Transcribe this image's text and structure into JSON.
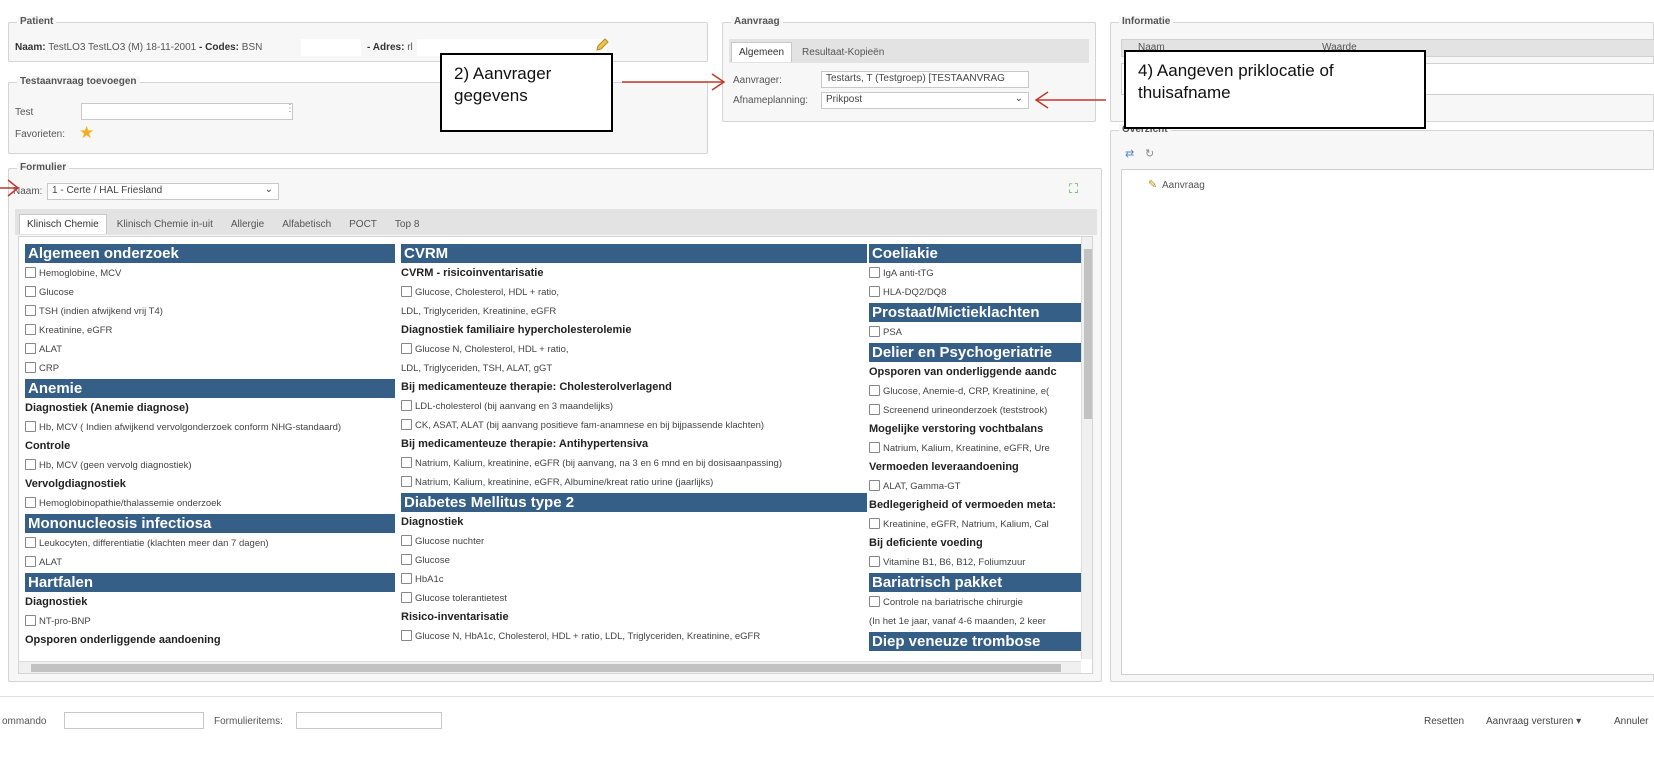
{
  "patient": {
    "legend": "Patient",
    "naam_label": "Naam:",
    "naam_value": "TestLO3 TestLO3 (M) 18-11-2001",
    "codes_label": "- Codes:",
    "bsn_label": "BSN",
    "adres_label": "- Adres:",
    "adres_value": "rl"
  },
  "testaanvraag": {
    "legend": "Testaanvraag toevoegen",
    "test_label": "Test",
    "favorieten_label": "Favorieten:"
  },
  "aanvraag": {
    "legend": "Aanvraag",
    "tabs": [
      "Algemeen",
      "Resultaat-Kopieën"
    ],
    "aanvrager_label": "Aanvrager:",
    "aanvrager_value": "Testarts, T (Testgroep) [TESTAANVRAG",
    "afname_label": "Afnameplanning:",
    "afname_value": "Prikpost"
  },
  "informatie": {
    "legend": "Informatie",
    "col_naam": "Naam",
    "col_waarde": "Waarde",
    "overzicht_legend": "Overzicht",
    "tree_item": "Aanvraag"
  },
  "formulier": {
    "legend": "Formulier",
    "naam_label": "Naam:",
    "naam_value": "1 - Certe / HAL Friesland",
    "tabs": [
      "Klinisch Chemie",
      "Klinisch Chemie in-uit",
      "Allergie",
      "Alfabetisch",
      "POCT",
      "Top 8"
    ]
  },
  "col1": [
    {
      "t": "h",
      "v": "Algemeen onderzoek"
    },
    {
      "t": "c",
      "v": "Hemoglobine, MCV"
    },
    {
      "t": "c",
      "v": "Glucose"
    },
    {
      "t": "c",
      "v": "TSH (indien afwijkend vrij T4)"
    },
    {
      "t": "c",
      "v": "Kreatinine, eGFR"
    },
    {
      "t": "c",
      "v": "ALAT"
    },
    {
      "t": "c",
      "v": "CRP"
    },
    {
      "t": "h",
      "v": "Anemie"
    },
    {
      "t": "s",
      "v": "Diagnostiek (Anemie diagnose)"
    },
    {
      "t": "c",
      "v": "Hb, MCV ( Indien afwijkend vervolgonderzoek conform NHG-standaard)"
    },
    {
      "t": "s",
      "v": "Controle"
    },
    {
      "t": "c",
      "v": "Hb, MCV (geen vervolg diagnostiek)"
    },
    {
      "t": "s",
      "v": "Vervolgdiagnostiek"
    },
    {
      "t": "c",
      "v": "Hemoglobinopathie/thalassemie onderzoek"
    },
    {
      "t": "h",
      "v": "Mononucleosis infectiosa"
    },
    {
      "t": "c",
      "v": "Leukocyten, differentiatie (klachten meer dan 7 dagen)"
    },
    {
      "t": "c",
      "v": "ALAT"
    },
    {
      "t": "h",
      "v": "Hartfalen"
    },
    {
      "t": "s",
      "v": "Diagnostiek"
    },
    {
      "t": "c",
      "v": "NT-pro-BNP"
    },
    {
      "t": "s",
      "v": "Opsporen onderliggende aandoening"
    }
  ],
  "col2": [
    {
      "t": "h",
      "v": "CVRM"
    },
    {
      "t": "s",
      "v": "CVRM - risicoinventarisatie"
    },
    {
      "t": "c",
      "v": "Glucose, Cholesterol, HDL + ratio,"
    },
    {
      "t": "p",
      "v": "LDL, Triglyceriden, Kreatinine, eGFR"
    },
    {
      "t": "s",
      "v": "Diagnostiek familiaire hypercholesterolemie"
    },
    {
      "t": "c",
      "v": "Glucose N, Cholesterol, HDL + ratio,"
    },
    {
      "t": "p",
      "v": "LDL, Triglyceriden, TSH, ALAT, gGT"
    },
    {
      "t": "s",
      "v": "Bij medicamenteuze therapie: Cholesterolverlagend"
    },
    {
      "t": "c",
      "v": "LDL-cholesterol (bij aanvang en 3 maandelijks)"
    },
    {
      "t": "c",
      "v": "CK, ASAT, ALAT (bij aanvang positieve fam-anamnese en bij bijpassende klachten)"
    },
    {
      "t": "s",
      "v": "Bij medicamenteuze therapie: Antihypertensiva"
    },
    {
      "t": "c",
      "v": "Natrium, Kalium, kreatinine, eGFR (bij aanvang, na 3 en 6 mnd en bij dosisaanpassing)"
    },
    {
      "t": "c",
      "v": "Natrium, Kalium, kreatinine, eGFR, Albumine/kreat ratio urine (jaarlijks)"
    },
    {
      "t": "h",
      "v": "Diabetes Mellitus type 2"
    },
    {
      "t": "s",
      "v": "Diagnostiek"
    },
    {
      "t": "c",
      "v": "Glucose nuchter"
    },
    {
      "t": "c",
      "v": "Glucose"
    },
    {
      "t": "c",
      "v": "HbA1c"
    },
    {
      "t": "c",
      "v": "Glucose tolerantietest"
    },
    {
      "t": "s",
      "v": "Risico-inventarisatie"
    },
    {
      "t": "c",
      "v": "Glucose N, HbA1c, Cholesterol, HDL + ratio, LDL, Triglyceriden, Kreatinine, eGFR"
    }
  ],
  "col3": [
    {
      "t": "h",
      "v": "Coeliakie"
    },
    {
      "t": "c",
      "v": "IgA anti-tTG"
    },
    {
      "t": "c",
      "v": "HLA-DQ2/DQ8"
    },
    {
      "t": "h",
      "v": "Prostaat/Mictieklachten"
    },
    {
      "t": "c",
      "v": "PSA"
    },
    {
      "t": "h",
      "v": "Delier en Psychogeriatrie"
    },
    {
      "t": "s",
      "v": "Opsporen van onderliggende aandc"
    },
    {
      "t": "c",
      "v": "Glucose, Anemie-d, CRP, Kreatinine, e("
    },
    {
      "t": "c",
      "v": "Screenend urineonderzoek (teststrook)"
    },
    {
      "t": "s",
      "v": "Mogelijke verstoring vochtbalans"
    },
    {
      "t": "c",
      "v": "Natrium, Kalium, Kreatinine, eGFR, Ure"
    },
    {
      "t": "s",
      "v": "Vermoeden leveraandoening"
    },
    {
      "t": "c",
      "v": "ALAT, Gamma-GT"
    },
    {
      "t": "s",
      "v": "Bedlegerigheid of vermoeden meta:"
    },
    {
      "t": "c",
      "v": "Kreatinine, eGFR, Natrium, Kalium, Cal"
    },
    {
      "t": "s",
      "v": "Bij deficiente voeding"
    },
    {
      "t": "c",
      "v": "Vitamine B1, B6, B12, Foliumzuur"
    },
    {
      "t": "h",
      "v": "Bariatrisch pakket"
    },
    {
      "t": "c",
      "v": "Controle na bariatrische chirurgie"
    },
    {
      "t": "p",
      "v": "(In het 1e jaar, vanaf 4-6 maanden, 2 keer"
    },
    {
      "t": "h",
      "v": "Diep veneuze trombose"
    }
  ],
  "bottom": {
    "commando_label": "ommando",
    "formulieritems_label": "Formulieritems:",
    "resetten": "Resetten",
    "versturen": "Aanvraag versturen",
    "annuleren": "Annuler"
  },
  "annotations": {
    "a2": "2) Aanvrager gegevens",
    "a4": "4) Aangeven priklocatie of thuisafname"
  },
  "colors": {
    "section_header": "#355f86",
    "arrow": "#c0392b"
  }
}
